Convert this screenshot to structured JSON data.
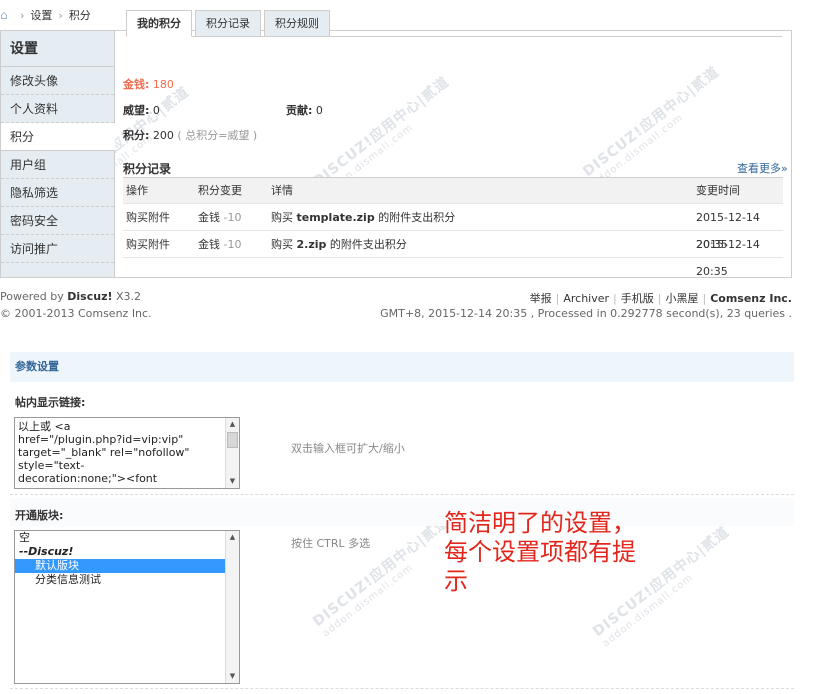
{
  "breadcrumb": {
    "items": [
      "设置",
      "积分"
    ]
  },
  "sidebar": {
    "title": "设置",
    "items": [
      {
        "label": "修改头像",
        "active": false
      },
      {
        "label": "个人资料",
        "active": false
      },
      {
        "label": "积分",
        "active": true
      },
      {
        "label": "用户组",
        "active": false
      },
      {
        "label": "隐私筛选",
        "active": false
      },
      {
        "label": "密码安全",
        "active": false
      },
      {
        "label": "访问推广",
        "active": false
      }
    ]
  },
  "tabs": [
    {
      "label": "我的积分",
      "active": true
    },
    {
      "label": "积分记录",
      "active": false
    },
    {
      "label": "积分规则",
      "active": false
    }
  ],
  "credits": {
    "money_label": "金钱:",
    "money_value": "180",
    "prestige_label": "威望:",
    "prestige_value": "0",
    "contrib_label": "贡献:",
    "contrib_value": "0",
    "total_label": "积分:",
    "total_value": "200",
    "total_note": "( 总积分=威望 )"
  },
  "records": {
    "title": "积分记录",
    "more": "查看更多»",
    "columns": [
      "操作",
      "积分变更",
      "详情",
      "变更时间"
    ],
    "rows": [
      {
        "action": "购买附件",
        "currency": "金钱",
        "amount": "-10",
        "detail_pre": "购买",
        "file": "template.zip",
        "detail_post": "的附件支出积分",
        "time": "2015-12-14 20:35"
      },
      {
        "action": "购买附件",
        "currency": "金钱",
        "amount": "-10",
        "detail_pre": "购买",
        "file": "2.zip",
        "detail_post": "的附件支出积分",
        "time": "2015-12-14 20:35"
      }
    ]
  },
  "footer": {
    "powered_pre": "Powered by",
    "powered_brand": "Discuz!",
    "version": "X3.2",
    "copyright": "© 2001-2013 Comsenz Inc.",
    "links": [
      "举报",
      "Archiver",
      "手机版",
      "小黑屋"
    ],
    "company": "Comsenz Inc.",
    "info": "GMT+8, 2015-12-14 20:35 , Processed in 0.292778 second(s), 23 queries ."
  },
  "settings": {
    "title": "参数设置",
    "link_label": "帖内显示链接:",
    "link_value": "以上或 <a\nhref=\"/plugin.php?id=vip:vip\"\ntarget=\"_blank\" rel=\"nofollow\"\nstyle=\"text-\ndecoration:none;\"><font",
    "link_hint": "双击输入框可扩大/缩小",
    "forum_label": "开通版块:",
    "forum_hint": "按住 CTRL 多选",
    "forum_options": [
      {
        "label": "空",
        "kind": "plain",
        "selected": false
      },
      {
        "label": "--Discuz!",
        "kind": "group",
        "selected": false
      },
      {
        "label": "默认版块",
        "kind": "child",
        "selected": true
      },
      {
        "label": "分类信息测试",
        "kind": "child",
        "selected": false
      }
    ]
  },
  "annotation": "简洁明了的设置，每个设置项都有提示",
  "watermark": {
    "brand": "DISCUZ!应用中心|贰道",
    "domain": "addon.dismall.com"
  },
  "colors": {
    "money": "#f26c4f",
    "link": "#336699",
    "annotation": "#e3261c",
    "selected": "#3399ff"
  }
}
